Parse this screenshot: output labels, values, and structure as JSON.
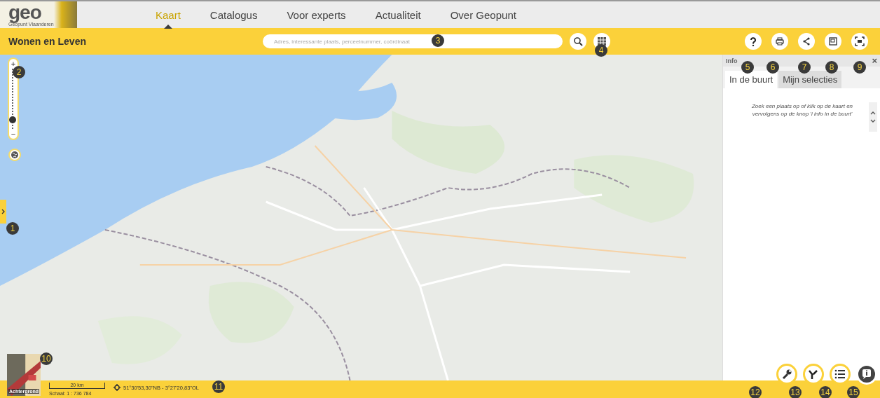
{
  "logo": {
    "wordmark": "geo",
    "subtitle": "Geopunt Vlaanderen"
  },
  "nav": [
    {
      "label": "Kaart",
      "selected": true
    },
    {
      "label": "Catalogus",
      "selected": false
    },
    {
      "label": "Voor experts",
      "selected": false
    },
    {
      "label": "Actualiteit",
      "selected": false
    },
    {
      "label": "Over Geopunt",
      "selected": false
    }
  ],
  "toolbar": {
    "title": "Wonen en Leven",
    "search": {
      "placeholder": "Adres, interessante plaats, perceelnummer, coördinaat"
    }
  },
  "map": {
    "zoom_slider": {
      "plus": "+",
      "minus": "−",
      "level": 0.15
    }
  },
  "info_panel": {
    "title": "Info",
    "close": "×",
    "tabs": [
      {
        "label": "In de buurt",
        "selected": true
      },
      {
        "label": "Mijn selecties",
        "selected": false
      }
    ],
    "message": "Zoek een plaats op of klik op de kaart en vervolgens op de knop 'i info in de buurt'"
  },
  "status_bar": {
    "background_label": "Achtergrond",
    "scale_bar": "20 km",
    "scale": "Schaal: 1 : 736 784",
    "coordinates": "51°30'53,30\"NB - 3°27'20,83\"OL"
  },
  "callouts": [
    "1",
    "2",
    "3",
    "4",
    "5",
    "6",
    "7",
    "8",
    "9",
    "10",
    "11",
    "12",
    "13",
    "14",
    "15"
  ]
}
